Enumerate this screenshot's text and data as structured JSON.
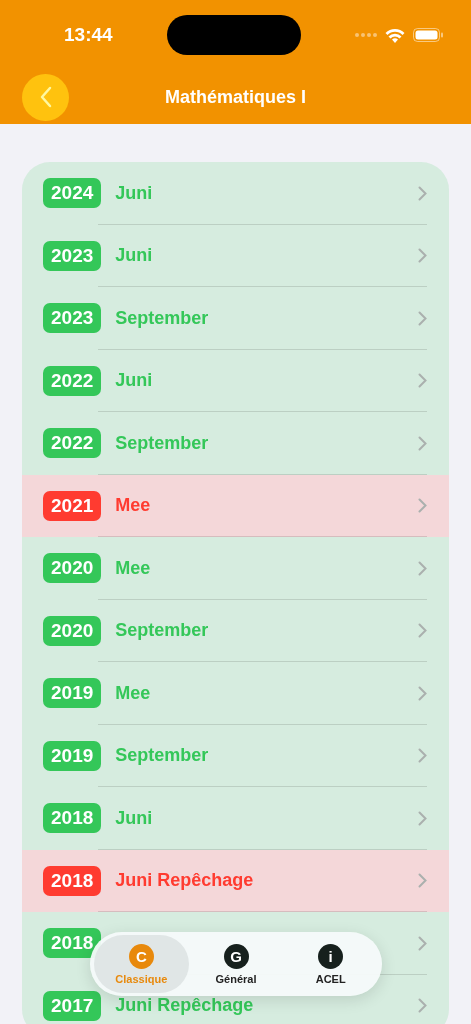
{
  "status_bar": {
    "time": "13:44"
  },
  "nav": {
    "title": "Mathématiques I"
  },
  "sessions": [
    {
      "year": "2024",
      "label": "Juni",
      "color": "#34c759"
    },
    {
      "year": "2023",
      "label": "Juni",
      "color": "#34c759"
    },
    {
      "year": "2023",
      "label": "September",
      "color": "#34c759"
    },
    {
      "year": "2022",
      "label": "Juni",
      "color": "#34c759"
    },
    {
      "year": "2022",
      "label": "September",
      "color": "#34c759"
    },
    {
      "year": "2021",
      "label": "Mee",
      "color": "#ff3b30"
    },
    {
      "year": "2020",
      "label": "Mee",
      "color": "#34c759"
    },
    {
      "year": "2020",
      "label": "September",
      "color": "#34c759"
    },
    {
      "year": "2019",
      "label": "Mee",
      "color": "#34c759"
    },
    {
      "year": "2019",
      "label": "September",
      "color": "#34c759"
    },
    {
      "year": "2018",
      "label": "Juni",
      "color": "#34c759"
    },
    {
      "year": "2018",
      "label": "Juni Repêchage",
      "color": "#ff3b30"
    },
    {
      "year": "2018",
      "color": "#34c759"
    },
    {
      "year": "2017",
      "label": "Juni Repêchage",
      "color": "#34c759"
    }
  ],
  "tab_bar": [
    {
      "letter": "C",
      "label": "Classique",
      "selected": true
    },
    {
      "letter": "G",
      "label": "Général",
      "selected": false
    },
    {
      "letter": "i",
      "label": "ACEL",
      "selected": false
    }
  ]
}
